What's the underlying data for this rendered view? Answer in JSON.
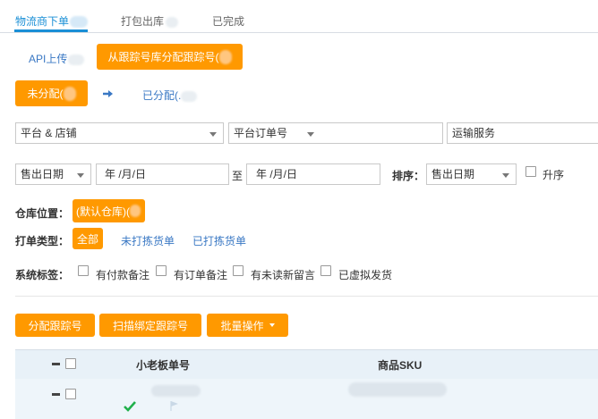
{
  "tabs": [
    {
      "label": "物流商下单",
      "active": true
    },
    {
      "label": "打包出库",
      "active": false
    },
    {
      "label": "已完成",
      "active": false
    }
  ],
  "subtabs": {
    "api_upload": "API上传",
    "assign_from_pool": "从跟踪号库分配跟踪号("
  },
  "status": {
    "unassigned": "未分配(",
    "assigned": "已分配(."
  },
  "filters": {
    "platform_store": "平台 & 店铺",
    "platform_order": "平台订单号",
    "shipping_service": "运输服务",
    "sale_date": "售出日期",
    "date_from": "年 /月/日",
    "to": "至",
    "date_to": "年 /月/日",
    "sort_label": "排序：",
    "sort_value": "售出日期",
    "ascending": "升序"
  },
  "warehouse": {
    "label": "仓库位置：",
    "value": "(默认仓库)("
  },
  "print_type": {
    "label": "打单类型：",
    "options": [
      "全部",
      "未打拣货单",
      "已打拣货单"
    ]
  },
  "system_tags": {
    "label": "系统标签：",
    "options": [
      "有付款备注",
      "有订单备注",
      "有未读新留言",
      "已虚拟发货"
    ]
  },
  "actions": {
    "assign_tracking": "分配跟踪号",
    "scan_bind": "扫描绑定跟踪号",
    "batch_ops": "批量操作"
  },
  "table": {
    "columns": [
      "小老板单号",
      "商品SKU"
    ]
  },
  "colors": {
    "accent_orange": "#ff9900",
    "tab_blue": "#1a8fd6",
    "link_blue": "#3a78c4",
    "check_green": "#20b04b"
  }
}
